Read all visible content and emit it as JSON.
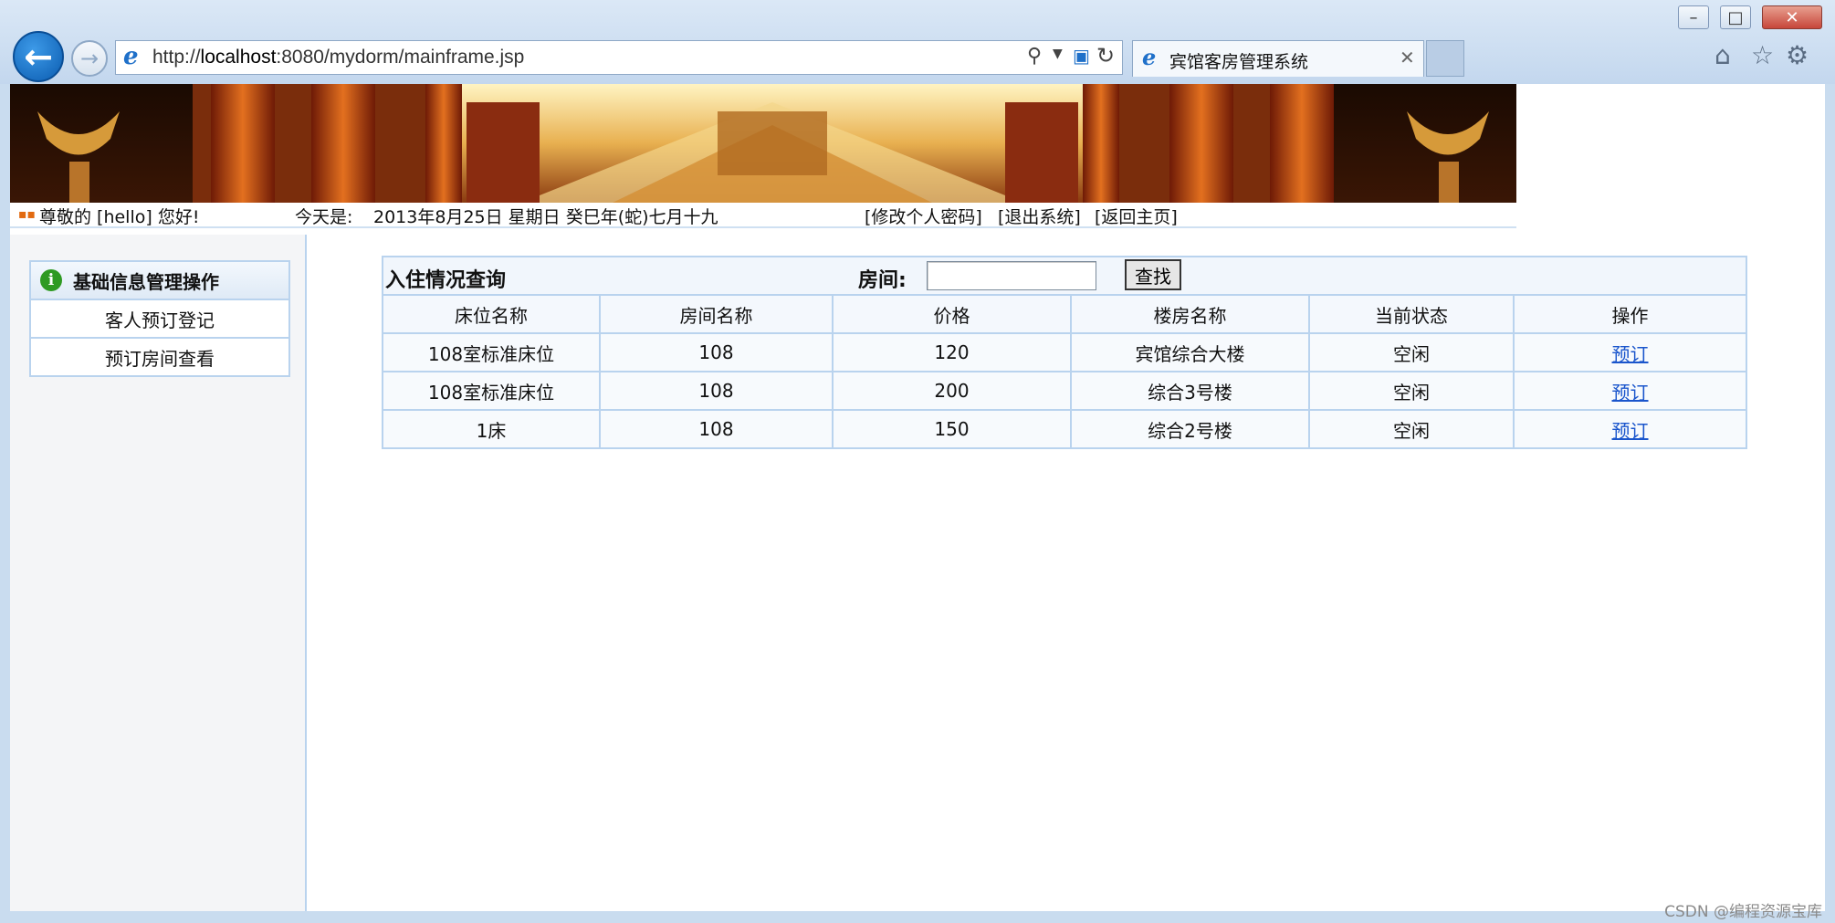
{
  "browser": {
    "url_prefix": "http://",
    "url_host": "localhost",
    "url_rest": ":8080/mydorm/mainframe.jsp",
    "tab_title": "宾馆客房管理系统"
  },
  "infobar": {
    "greeting": "尊敬的 [hello] 您好!",
    "date_label": "今天是:",
    "date_value": "2013年8月25日 星期日 癸巳年(蛇)七月十九",
    "change_password": "[修改个人密码]",
    "logout": "[退出系统]",
    "home": "[返回主页]"
  },
  "sidebar": {
    "heading": "基础信息管理操作",
    "items": [
      {
        "label": "客人预订登记"
      },
      {
        "label": "预订房间查看"
      }
    ]
  },
  "query": {
    "title": "入住情况查询",
    "room_label": "房间:",
    "room_value": "",
    "search_label": "查找",
    "columns": [
      "床位名称",
      "房间名称",
      "价格",
      "楼房名称",
      "当前状态",
      "操作"
    ],
    "rows": [
      [
        "108室标准床位",
        "108",
        "120",
        "宾馆综合大楼",
        "空闲",
        "预订"
      ],
      [
        "108室标准床位",
        "108",
        "200",
        "综合3号楼",
        "空闲",
        "预订"
      ],
      [
        "1床",
        "108",
        "150",
        "综合2号楼",
        "空闲",
        "预订"
      ]
    ]
  },
  "watermark": "CSDN @编程资源宝库",
  "colors": {
    "border": "#b9d3ee",
    "link": "#1a55cc",
    "back_button": "#0b5cb0"
  }
}
